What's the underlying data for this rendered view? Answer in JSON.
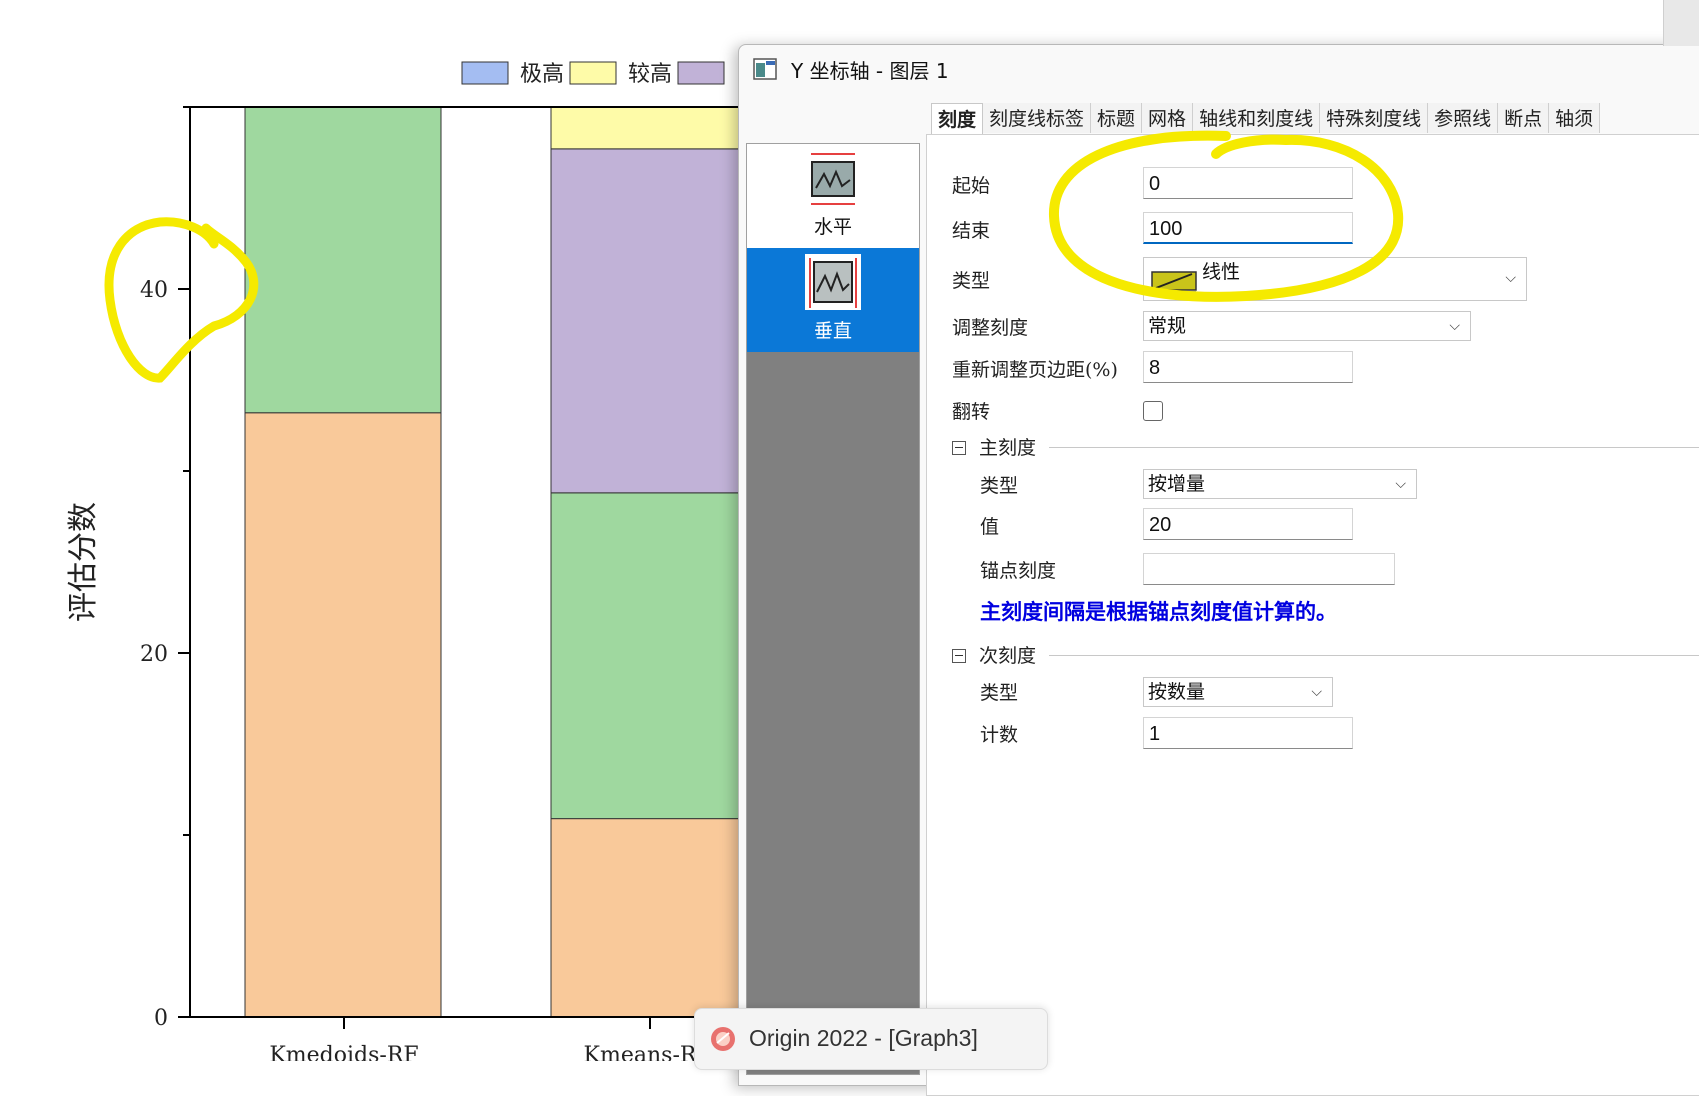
{
  "chart_data": {
    "type": "bar",
    "stacked": true,
    "ylabel": "评估分数",
    "ylim": [
      0,
      50
    ],
    "yticks": [
      "0",
      "20",
      "40"
    ],
    "ytick_values": [
      0,
      20,
      40
    ],
    "legend": [
      {
        "name": "极高",
        "color": "#a4bdf2"
      },
      {
        "name": "较高",
        "color": "#fefba8"
      },
      {
        "name": "",
        "color": "#c1b2d7"
      }
    ],
    "categories": [
      "Kmedoids-RF",
      "Kmeans-R"
    ],
    "bars": [
      {
        "category": "Kmedoids-RF",
        "segments": [
          {
            "color": "#f9c99a",
            "from": 0,
            "to": 33.2
          },
          {
            "color": "#9fd89f",
            "from": 33.2,
            "to": 50
          }
        ]
      },
      {
        "category": "Kmeans-R",
        "segments": [
          {
            "color": "#f9c99a",
            "from": 0,
            "to": 10.9
          },
          {
            "color": "#9fd89f",
            "from": 10.9,
            "to": 28.8
          },
          {
            "color": "#c1b2d7",
            "from": 28.8,
            "to": 47.7
          },
          {
            "color": "#fefba8",
            "from": 47.7,
            "to": 50
          }
        ]
      }
    ],
    "highlight_color": "#f5ea00"
  },
  "dialog": {
    "title": "Y 坐标轴 - 图层 1",
    "tabs": [
      "刻度",
      "刻度线标签",
      "标题",
      "网格",
      "轴线和刻度线",
      "特殊刻度线",
      "参照线",
      "断点",
      "轴须"
    ],
    "active_tab": "刻度",
    "sidebar": {
      "horizontal": "水平",
      "vertical": "垂直",
      "selected": "垂直"
    },
    "fields": {
      "start_label": "起始",
      "start_value": "0",
      "end_label": "结束",
      "end_value": "100",
      "type_label": "类型",
      "type_value": "线性",
      "rescale_label": "调整刻度",
      "rescale_value": "常规",
      "margin_label": "重新调整页边距(%)",
      "margin_value": "8",
      "flip_label": "翻转"
    },
    "major": {
      "header": "主刻度",
      "type_label": "类型",
      "type_value": "按增量",
      "value_label": "值",
      "value_value": "20",
      "anchor_label": "锚点刻度",
      "anchor_value": "",
      "note": "主刻度间隔是根据锚点刻度值计算的。"
    },
    "minor": {
      "header": "次刻度",
      "type_label": "类型",
      "type_value": "按数量",
      "count_label": "计数",
      "count_value": "1"
    }
  },
  "taskbar": {
    "label": "Origin 2022 - [Graph3]"
  }
}
